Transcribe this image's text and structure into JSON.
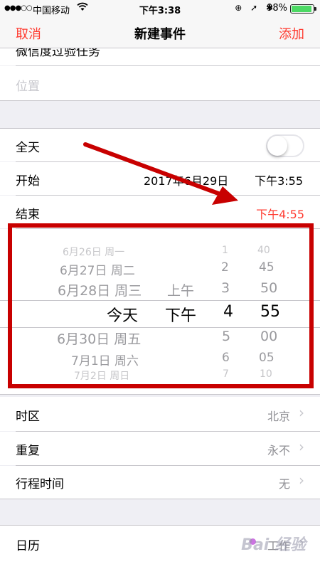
{
  "status_bar": {
    "signal": "●●●○○",
    "carrier": "中国移动",
    "wifi_icon": "wifi-icon",
    "time": "下午3:38",
    "icons": "⊕ ➚ ✱",
    "battery": "98%",
    "battery_level": 0.98
  },
  "nav": {
    "cancel": "取消",
    "title": "新建事件",
    "add": "添加"
  },
  "form": {
    "title_field_partial": "微信度过验任务",
    "location_placeholder": "位置",
    "all_day_label": "全天",
    "all_day_on": false,
    "start_label": "开始",
    "start_date": "2017年6月29日",
    "start_time": "下午3:55",
    "end_label": "结束",
    "end_time": "下午4:55",
    "timezone_label": "时区",
    "timezone_value": "北京",
    "repeat_label": "重复",
    "repeat_value": "永不",
    "travel_label": "行程时间",
    "travel_value": "无",
    "calendar_label": "日历",
    "calendar_value": "工作"
  },
  "picker": {
    "rows": [
      {
        "date": "6月26日 周一",
        "ampm": "",
        "hour": "1",
        "minute": "40"
      },
      {
        "date": "6月27日 周二",
        "ampm": "",
        "hour": "2",
        "minute": "45"
      },
      {
        "date": "6月28日 周三",
        "ampm": "上午",
        "hour": "3",
        "minute": "50"
      },
      {
        "date": "今天",
        "ampm": "下午",
        "hour": "4",
        "minute": "55"
      },
      {
        "date": "6月30日 周五",
        "ampm": "",
        "hour": "5",
        "minute": "00"
      },
      {
        "date": "7月1日 周六",
        "ampm": "",
        "hour": "6",
        "minute": "05"
      },
      {
        "date": "7月2日 周日",
        "ampm": "",
        "hour": "7",
        "minute": "10"
      }
    ]
  },
  "colors": {
    "accent": "#ff3b30",
    "annotation": "#c80000"
  },
  "watermark": "Bai 经验"
}
